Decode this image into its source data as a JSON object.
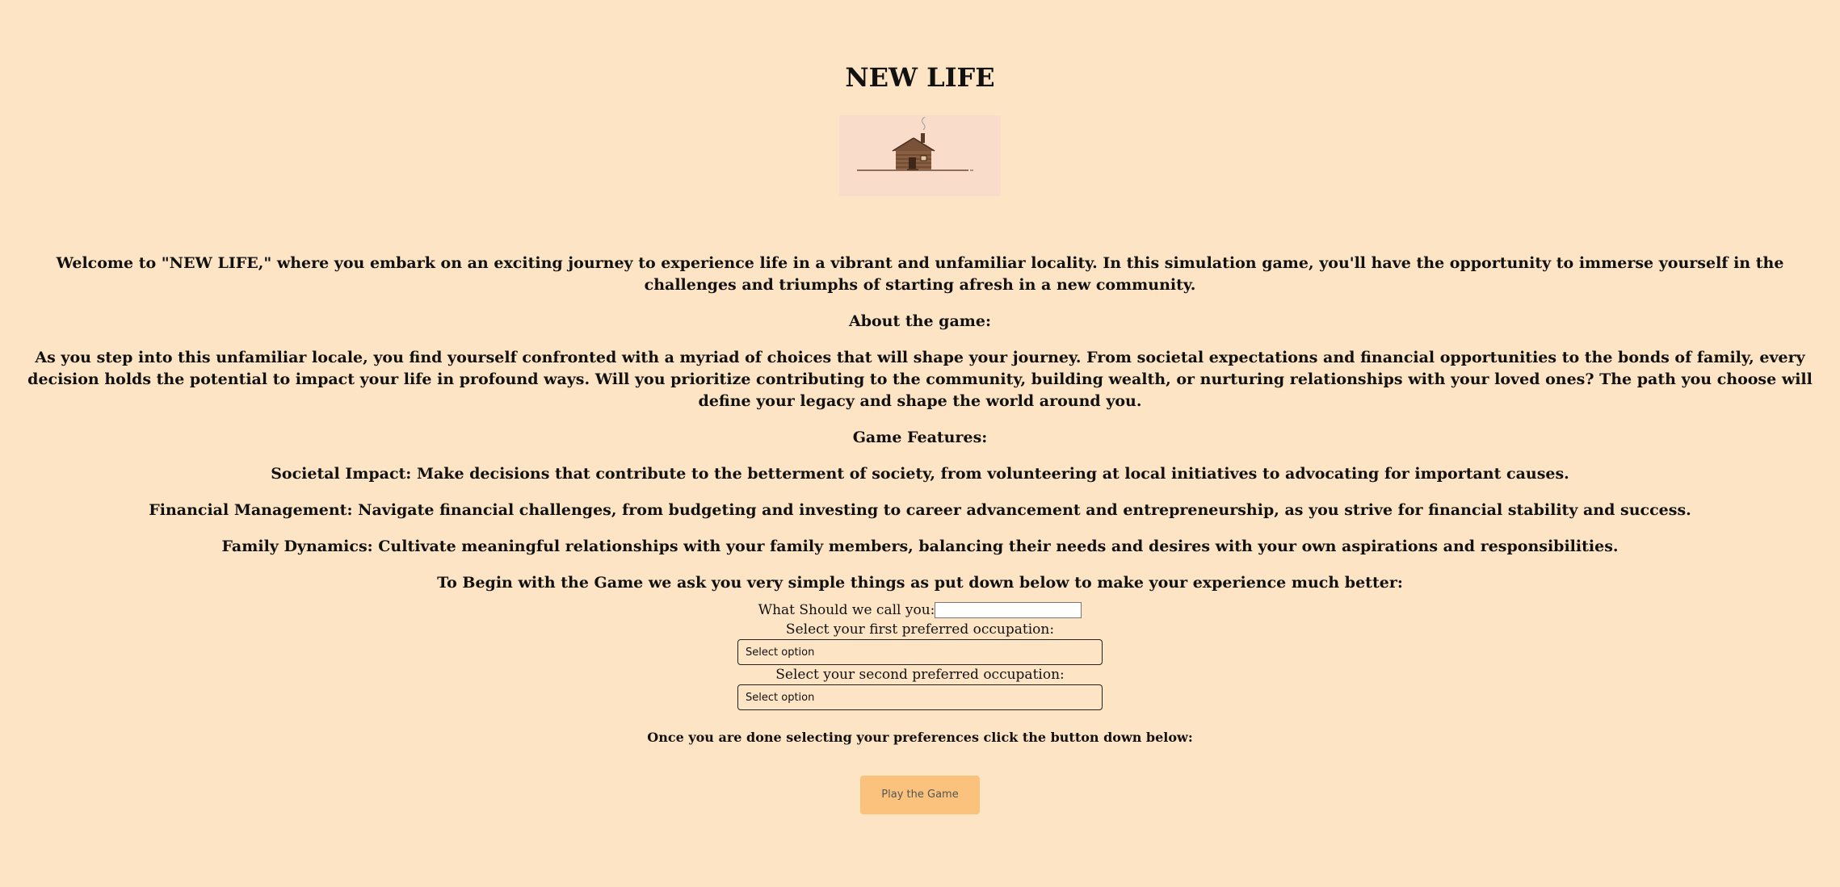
{
  "title": "NEW LIFE",
  "logo": {
    "icon": "log-cabin-icon"
  },
  "intro": "Welcome to \"NEW LIFE,\" where you embark on an exciting journey to experience life in a vibrant and unfamiliar locality. In this simulation game, you'll have the opportunity to immerse yourself in the challenges and triumphs of starting afresh in a new community.",
  "about_heading": "About the game:",
  "about_text": "As you step into this unfamiliar locale, you find yourself confronted with a myriad of choices that will shape your journey. From societal expectations and financial opportunities to the bonds of family, every decision holds the potential to impact your life in profound ways. Will you prioritize contributing to the community, building wealth, or nurturing relationships with your loved ones? The path you choose will define your legacy and shape the world around you.",
  "features_heading": "Game Features:",
  "features": [
    "Societal Impact: Make decisions that contribute to the betterment of society, from volunteering at local initiatives to advocating for important causes.",
    "Financial Management: Navigate financial challenges, from budgeting and investing to career advancement and entrepreneurship, as you strive for financial stability and success.",
    "Family Dynamics: Cultivate meaningful relationships with your family members, balancing their needs and desires with your own aspirations and responsibilities."
  ],
  "begin_text": "To Begin with the Game we ask you very simple things as put down below to make your experience much better:",
  "form": {
    "name_label": "What Should we call you:",
    "name_value": "",
    "first_label": "Select your first preferred occupation:",
    "first_value": "Select option",
    "second_label": "Select your second preferred occupation:",
    "second_value": "Select option"
  },
  "note": "Once you are done selecting your preferences click the button down below:",
  "play_button": "Play the Game"
}
